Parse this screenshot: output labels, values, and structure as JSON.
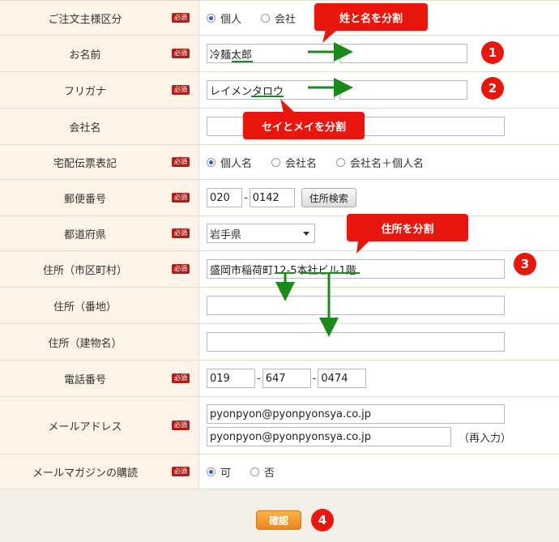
{
  "required_badge": "必須",
  "rows": {
    "order_type": {
      "label": "ご注文主様区分",
      "options": [
        "個人",
        "会社"
      ]
    },
    "name": {
      "label": "お名前",
      "last": "冷麺太郎",
      "first": ""
    },
    "kana": {
      "label": "フリガナ",
      "last": "レイメンタロウ",
      "first": ""
    },
    "company": {
      "label": "会社名",
      "value": ""
    },
    "slip": {
      "label": "宅配伝票表記",
      "options": [
        "個人名",
        "会社名",
        "会社名＋個人名"
      ]
    },
    "zip": {
      "label": "郵便番号",
      "part1": "020",
      "part2": "0142",
      "search_button": "住所検索",
      "dash": "-"
    },
    "pref": {
      "label": "都道府県",
      "value": "岩手県"
    },
    "addr1": {
      "label": "住所（市区町村）",
      "value": "盛岡市稲荷町12-5本社ビル1階"
    },
    "addr2": {
      "label": "住所（番地）",
      "value": ""
    },
    "addr3": {
      "label": "住所（建物名）",
      "value": ""
    },
    "tel": {
      "label": "電話番号",
      "p1": "019",
      "p2": "647",
      "p3": "0474",
      "dash": "-"
    },
    "email": {
      "label": "メールアドレス",
      "value": "pyonpyon@pyonpyonsya.co.jp",
      "confirm": "pyonpyon@pyonpyonsya.co.jp",
      "reenter_note": "（再入力）"
    },
    "magazine": {
      "label": "メールマガジンの購読",
      "options": [
        "可",
        "否"
      ]
    }
  },
  "annotations": {
    "split_name": "姓と名を分割",
    "split_kana": "セイとメイを分割",
    "split_address": "住所を分割",
    "steps": [
      "1",
      "2",
      "3",
      "4"
    ]
  },
  "confirm_button": "確認",
  "colors": {
    "callout": "#e8160c",
    "arrow": "#1b8a1b",
    "label_bg": "#fdf3e6",
    "required": "#b0201a",
    "confirm": "#f0a030"
  }
}
